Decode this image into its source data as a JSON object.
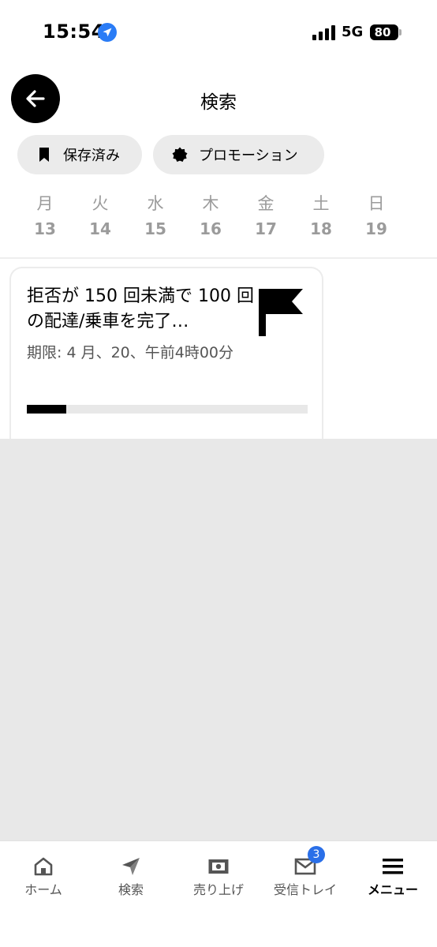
{
  "status_bar": {
    "time": "15:54",
    "network": "5G",
    "battery": "80",
    "location_icon": "location-arrow-icon",
    "signal_icon": "signal-bars-icon"
  },
  "header": {
    "back_icon": "arrow-left-icon",
    "title": "検索"
  },
  "chips": [
    {
      "label": "保存済み",
      "icon": "bookmark-icon"
    },
    {
      "label": "プロモーション",
      "icon": "badge-icon"
    }
  ],
  "week": [
    {
      "name": "月",
      "date": "13"
    },
    {
      "name": "火",
      "date": "14"
    },
    {
      "name": "水",
      "date": "15"
    },
    {
      "name": "木",
      "date": "16"
    },
    {
      "name": "金",
      "date": "17"
    },
    {
      "name": "土",
      "date": "18"
    },
    {
      "name": "日",
      "date": "19"
    }
  ],
  "card": {
    "title": "拒否が 150 回未満で 100 回の配達/乗車を完了…",
    "deadline": "期限: 4 月、20、午前4時00分",
    "icon": "flag-icon",
    "progress": 0.14
  },
  "nav": {
    "items": [
      {
        "label": "ホーム",
        "icon": "home-icon"
      },
      {
        "label": "検索",
        "icon": "compass-icon"
      },
      {
        "label": "売り上げ",
        "icon": "cash-icon"
      },
      {
        "label": "受信トレイ",
        "icon": "mail-icon"
      },
      {
        "label": "メニュー",
        "icon": "menu-icon"
      }
    ],
    "inbox_badge": "3"
  },
  "colors": {
    "accent": "#2a7cf6",
    "badge": "#2a6fe8",
    "chip_bg": "#ebebeb",
    "page_bg": "#e8e8e8"
  }
}
